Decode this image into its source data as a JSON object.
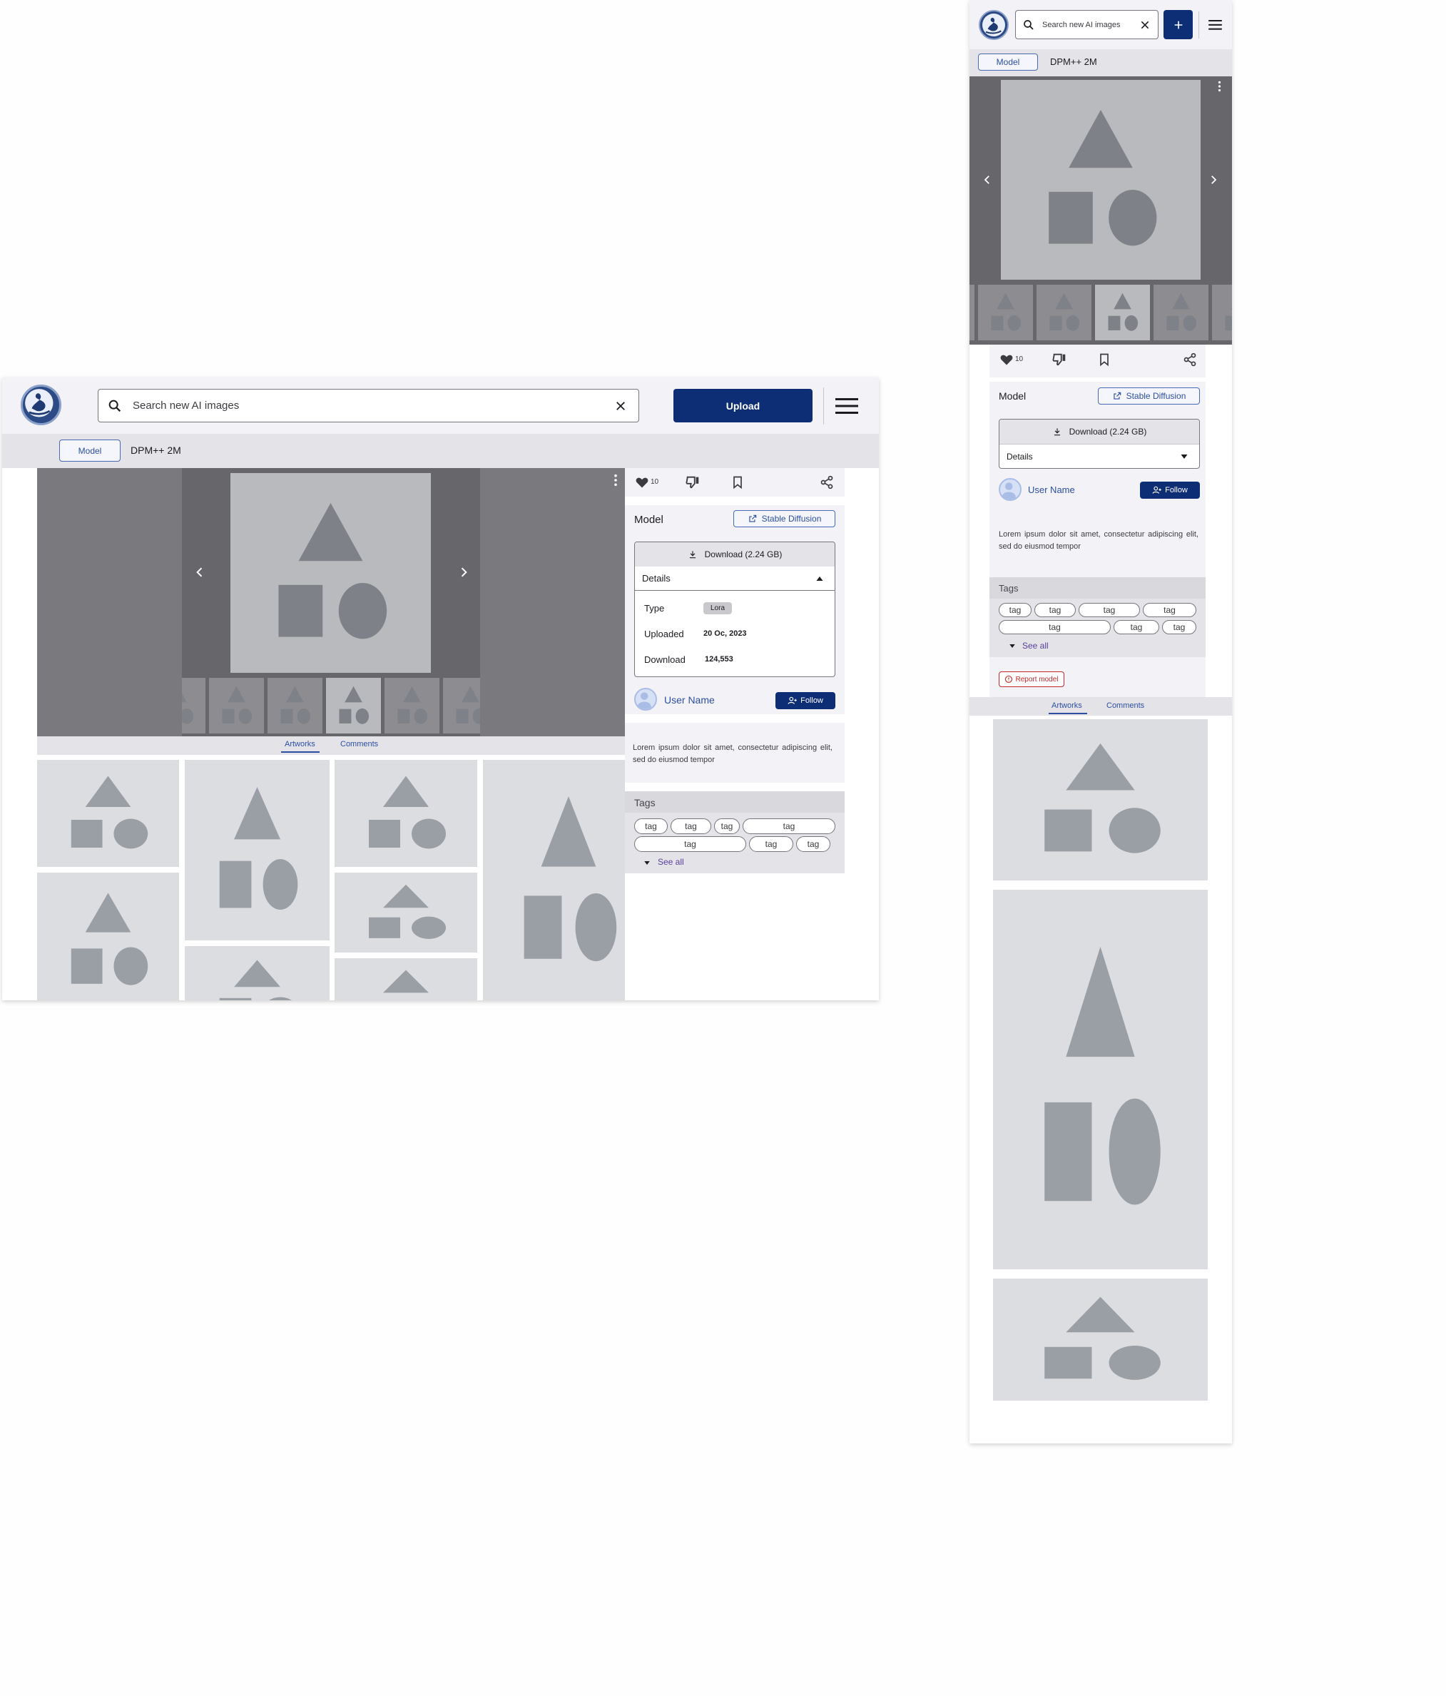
{
  "search": {
    "placeholder": "Search new AI images"
  },
  "header": {
    "upload_label": "Upload"
  },
  "subheader": {
    "model_chip": "Model",
    "sampler": "DPM++ 2M"
  },
  "actions": {
    "like_count": "10"
  },
  "model": {
    "label": "Model",
    "base_model": "Stable Diffusion",
    "download_label": "Download (2.24 GB)",
    "details_label": "Details",
    "type_label": "Type",
    "type_value": "Lora",
    "uploaded_label": "Uploaded",
    "uploaded_value": "20 Oc, 2023",
    "download_count_label": "Download",
    "download_count_value": "124,553"
  },
  "user": {
    "name": "User Name",
    "follow_label": "Follow"
  },
  "description": "Lorem ipsum dolor sit amet, consectetur adipiscing elit, sed do eiusmod tempor",
  "tags": {
    "title": "Tags",
    "items": [
      "tag",
      "tag",
      "tag",
      "tag",
      "tag",
      "tag",
      "tag"
    ],
    "see_all": "See all"
  },
  "tabs": {
    "artworks": "Artworks",
    "comments": "Comments"
  },
  "report_label": "Report model",
  "colors": {
    "primary": "#0d2d74",
    "accent": "#2d4fa3",
    "placeholder": "#dcdde1",
    "shape": "#9a9ea5",
    "report": "#c62828"
  }
}
